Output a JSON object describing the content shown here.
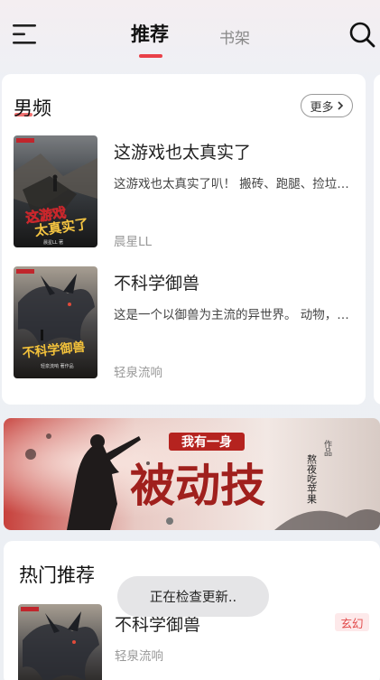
{
  "header": {
    "tabs": [
      {
        "label": "推荐",
        "active": true
      },
      {
        "label": "书架",
        "active": false
      }
    ],
    "icons": {
      "menu": "menu-icon",
      "search": "search-icon"
    },
    "accent_color": "#e94048"
  },
  "male_section": {
    "title": "男频",
    "more_label": "更多",
    "books": [
      {
        "title": "这游戏也太真实了",
        "description": "这游戏也太真实了叭！ 搬砖、跑腿、捡垃圾…",
        "author": "晨星LL",
        "cover_title": "这游戏也太真实了",
        "cover_author": "晨星LL 著"
      },
      {
        "title": "不科学御兽",
        "description": "这是一个以御兽为主流的异世界。 动物，植物…",
        "author": "轻泉流响",
        "cover_title": "不科学御兽",
        "cover_author": "轻泉流响 著作品"
      }
    ]
  },
  "banner": {
    "title_top": "我有一身",
    "title_main": "被动技",
    "author_credit": "熬夜吃苹果",
    "author_mark": "作品"
  },
  "hot_section": {
    "title": "热门推荐",
    "book": {
      "title": "不科学御兽",
      "author": "轻泉流响",
      "genre": "玄幻"
    }
  },
  "toast": {
    "text": "正在检查更新.."
  }
}
